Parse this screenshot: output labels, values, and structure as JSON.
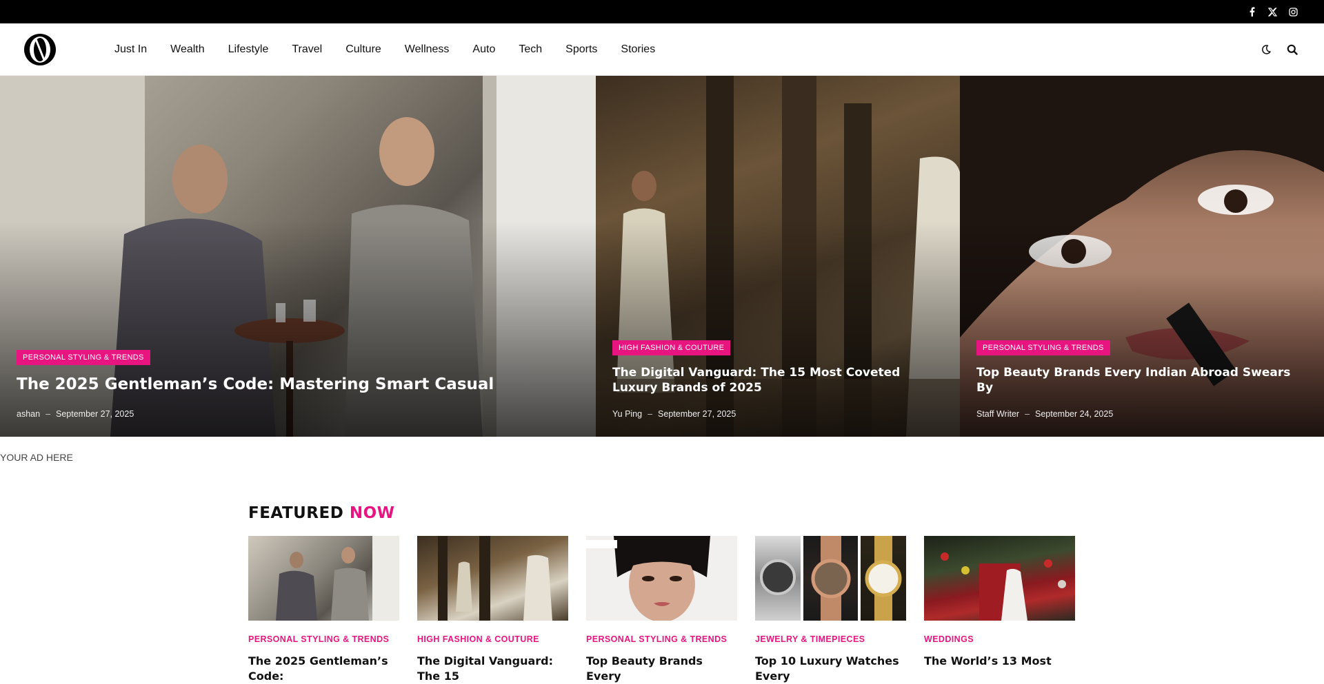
{
  "social": [
    {
      "name": "facebook",
      "glyph": "f"
    },
    {
      "name": "x",
      "glyph": "𝕏"
    },
    {
      "name": "instagram",
      "glyph": "◎"
    }
  ],
  "nav": {
    "items": [
      "Just In",
      "Wealth",
      "Lifestyle",
      "Travel",
      "Culture",
      "Wellness",
      "Auto",
      "Tech",
      "Sports",
      "Stories"
    ]
  },
  "hero": [
    {
      "category": "PERSONAL STYLING & TRENDS",
      "title": "The 2025 Gentleman’s Code: Mastering Smart Casual",
      "author": "ashan",
      "date": "September 27, 2025"
    },
    {
      "category": "HIGH FASHION & COUTURE",
      "title": "The Digital Vanguard: The 15 Most Coveted Luxury Brands of 2025",
      "author": "Yu Ping",
      "date": "September 27, 2025"
    },
    {
      "category": "PERSONAL STYLING & TRENDS",
      "title": "Top Beauty Brands Every Indian Abroad Swears By",
      "author": "Staff Writer",
      "date": "September 24, 2025"
    }
  ],
  "byline_separator": "–",
  "ad_text": "YOUR AD HERE",
  "featured": {
    "heading_main": "FEATURED",
    "heading_accent": "NOW",
    "cards": [
      {
        "category": "PERSONAL STYLING & TRENDS",
        "title": "The 2025 Gentleman’s Code:"
      },
      {
        "category": "HIGH FASHION & COUTURE",
        "title": "The Digital Vanguard: The 15"
      },
      {
        "category": "PERSONAL STYLING & TRENDS",
        "title": "Top Beauty Brands Every"
      },
      {
        "category": "JEWELRY & TIMEPIECES",
        "title": "Top 10 Luxury Watches Every"
      },
      {
        "category": "WEDDINGS",
        "title": "The World’s 13 Most"
      }
    ]
  },
  "colors": {
    "accent": "#e8147f",
    "topbar": "#000000"
  }
}
